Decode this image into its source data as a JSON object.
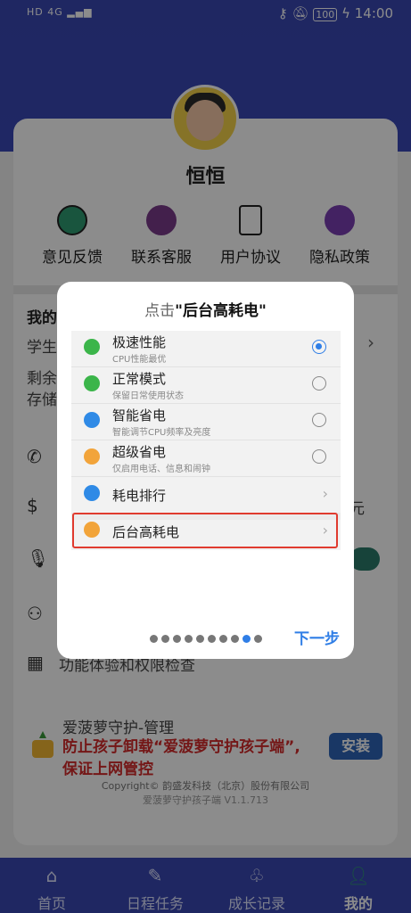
{
  "status_bar": {
    "left_indicators": "HD 4G ▂▄▆",
    "time": "14:00",
    "battery": "100"
  },
  "profile": {
    "name": "恒恒"
  },
  "menu": [
    {
      "label": "意见反馈",
      "icon": "feedback-icon",
      "color": "#2e9b72"
    },
    {
      "label": "联系客服",
      "icon": "customer-service-icon",
      "color": "#7a3b8a"
    },
    {
      "label": "用户协议",
      "icon": "document-icon",
      "color": "#333333"
    },
    {
      "label": "隐私政策",
      "icon": "lock-icon",
      "color": "#7b3fb3"
    }
  ],
  "background_list": {
    "section_title": "我的",
    "row1": "学生",
    "row2a": "剩余",
    "row2b": "存储",
    "right_text": "元",
    "feature_row": "功能体验和权限检查"
  },
  "ad": {
    "title": "爱菠萝守护-管理",
    "line1": "防止孩子卸载“爱菠萝守护孩子端”,",
    "line2": "保证上网管控",
    "install": "安装"
  },
  "footer": {
    "copyright": "Copyright© 韵盛发科技（北京）股份有限公司",
    "version": "爱菠萝守护孩子端 V1.1.713"
  },
  "tabs": [
    {
      "label": "首页",
      "icon": "home-icon"
    },
    {
      "label": "日程任务",
      "icon": "schedule-icon"
    },
    {
      "label": "成长记录",
      "icon": "sprout-icon"
    },
    {
      "label": "我的",
      "icon": "person-icon",
      "active": true
    }
  ],
  "dialog": {
    "title_prefix": "点击",
    "title_highlight": "\"后台高耗电\"",
    "options": [
      {
        "title": "极速性能",
        "subtitle": "CPU性能最优",
        "icon_color": "#3bb54a",
        "selected": true
      },
      {
        "title": "正常模式",
        "subtitle": "保留日常使用状态",
        "icon_color": "#3bb54a",
        "selected": false
      },
      {
        "title": "智能省电",
        "subtitle": "智能调节CPU频率及亮度",
        "icon_color": "#2f8ae6",
        "selected": false
      },
      {
        "title": "超级省电",
        "subtitle": "仅启用电话、信息和闹钟",
        "icon_color": "#f2a43a",
        "selected": false
      }
    ],
    "links": [
      {
        "title": "耗电排行",
        "icon_color": "#2f8ae6"
      },
      {
        "title": "后台高耗电",
        "icon_color": "#f2a43a"
      }
    ],
    "next_label": "下一步",
    "page_total": 10,
    "page_current": 9
  }
}
